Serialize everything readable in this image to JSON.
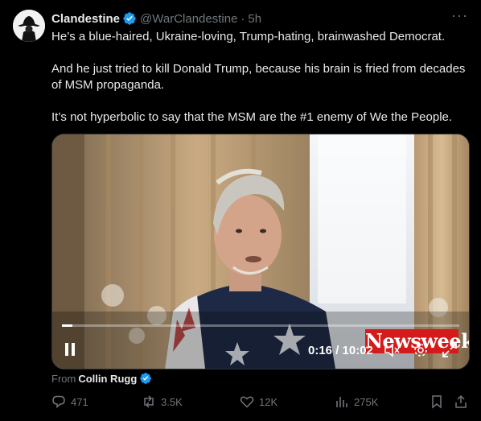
{
  "tweet": {
    "author": {
      "display_name": "Clandestine",
      "handle": "@WarClandestine",
      "separator": "·",
      "time": "5h",
      "verified": true
    },
    "paragraphs": [
      "He’s a blue-haired, Ukraine-loving, Trump-hating, brainwashed Democrat.",
      "And he just tried to kill Donald Trump, because his brain is fried from decades of MSM propaganda.",
      "It’s not hyperbolic to say that the MSM are the #1 enemy of We the People."
    ],
    "more_icon": "more-horizontal-icon"
  },
  "video": {
    "time_current": "0:16",
    "time_separator": "/",
    "time_total": "10:02",
    "time_display": "0:16 / 10:02",
    "progress_fraction": 0.027,
    "watermark": "Newsweek",
    "controls": [
      "pause-icon",
      "mute-icon",
      "settings-icon",
      "fullscreen-icon"
    ],
    "accent": "#d41a1a"
  },
  "source": {
    "prefix": "From",
    "name": "Collin Rugg",
    "verified": true
  },
  "actions": {
    "replies": "471",
    "reposts": "3.5K",
    "likes": "12K",
    "views": "275K",
    "icons": [
      "reply-icon",
      "repost-icon",
      "like-icon",
      "views-icon",
      "bookmark-icon",
      "share-icon"
    ]
  },
  "colors": {
    "background": "#000000",
    "text": "#e7e9ea",
    "muted": "#71767b",
    "verified": "#1d9bf0"
  }
}
